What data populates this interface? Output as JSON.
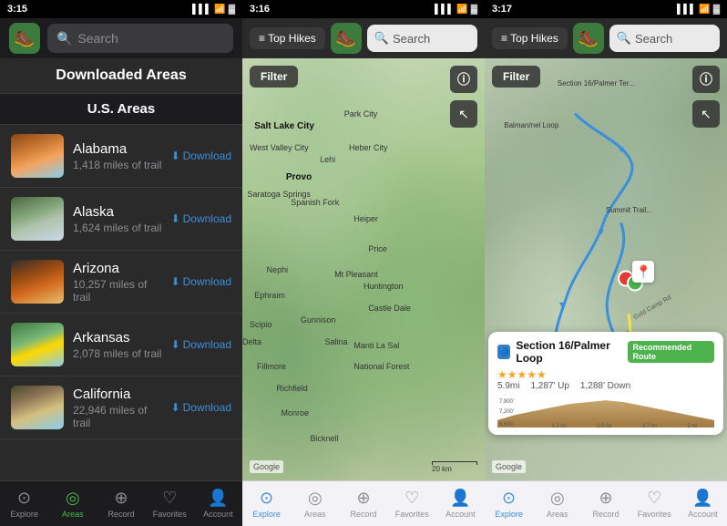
{
  "panels": [
    {
      "id": "panel-1",
      "status": {
        "time": "3:15",
        "signal": "▌▌▌",
        "wifi": "wifi",
        "battery": "🔋"
      },
      "nav": {
        "search_placeholder": "Search"
      },
      "section_title": "Downloaded Areas",
      "sub_section": "U.S. Areas",
      "areas": [
        {
          "name": "Alabama",
          "miles": "1,418 miles of trail",
          "thumb_class": "thumb-alabama"
        },
        {
          "name": "Alaska",
          "miles": "1,624 miles of trail",
          "thumb_class": "thumb-alaska"
        },
        {
          "name": "Arizona",
          "miles": "10,257 miles of trail",
          "thumb_class": "thumb-arizona"
        },
        {
          "name": "Arkansas",
          "miles": "2,078 miles of trail",
          "thumb_class": "thumb-arkansas"
        },
        {
          "name": "California",
          "miles": "22,946 miles of trail",
          "thumb_class": "thumb-california"
        }
      ],
      "download_label": "Download",
      "tabs": [
        {
          "id": "explore",
          "label": "Explore",
          "icon": "⊙",
          "active": false
        },
        {
          "id": "areas",
          "label": "Areas",
          "icon": "◎",
          "active": true
        },
        {
          "id": "record",
          "label": "Record",
          "icon": "⊕",
          "active": false
        },
        {
          "id": "favorites",
          "label": "Favorites",
          "icon": "♡",
          "active": false
        },
        {
          "id": "account",
          "label": "Account",
          "icon": "👤",
          "active": false
        }
      ]
    },
    {
      "id": "panel-2",
      "status": {
        "time": "3:16"
      },
      "nav": {
        "menu_label": "≡ Top Hikes",
        "search_placeholder": "Search"
      },
      "filter_btn": "Filter",
      "map_labels": [
        {
          "text": "Salt Lake City",
          "top": "15%",
          "left": "10%"
        },
        {
          "text": "Park City",
          "top": "13%",
          "left": "38%"
        },
        {
          "text": "West Valley City",
          "top": "18%",
          "left": "8%"
        },
        {
          "text": "Heber City",
          "top": "18%",
          "left": "42%"
        },
        {
          "text": "Provo",
          "top": "24%",
          "left": "18%",
          "bold": true
        },
        {
          "text": "Lehi",
          "top": "21%",
          "left": "30%"
        },
        {
          "text": "Saratoga Springs",
          "top": "28%",
          "left": "4%"
        },
        {
          "text": "Spanish Fork",
          "top": "31%",
          "left": "20%"
        },
        {
          "text": "Nephi",
          "top": "46%",
          "left": "14%"
        },
        {
          "text": "Ephraim",
          "top": "52%",
          "left": "9%"
        },
        {
          "text": "Scipio",
          "top": "58%",
          "left": "8%"
        },
        {
          "text": "Gunnison",
          "top": "57%",
          "left": "22%"
        },
        {
          "text": "Delta",
          "top": "63%",
          "left": "3%"
        },
        {
          "text": "Fillmore",
          "top": "68%",
          "left": "10%"
        },
        {
          "text": "Richfield",
          "top": "74%",
          "left": "16%"
        },
        {
          "text": "Monroe",
          "top": "80%",
          "left": "18%"
        },
        {
          "text": "Bicknell",
          "top": "86%",
          "left": "30%"
        },
        {
          "text": "Heiper",
          "top": "35%",
          "left": "45%"
        },
        {
          "text": "Price",
          "top": "42%",
          "left": "50%"
        },
        {
          "text": "Mt Pleasant",
          "top": "48%",
          "left": "38%"
        },
        {
          "text": "Huntington",
          "top": "50%",
          "left": "50%"
        },
        {
          "text": "Castle Dale",
          "top": "55%",
          "left": "52%"
        },
        {
          "text": "Salina",
          "top": "63%",
          "left": "35%"
        },
        {
          "text": "Manti La Sal",
          "top": "64%",
          "left": "48%"
        },
        {
          "text": "National Forest",
          "top": "68%",
          "left": "46%"
        }
      ],
      "google_label": "Google",
      "scale_label": "20 km",
      "tabs": [
        {
          "id": "explore",
          "label": "Explore",
          "icon": "⊙",
          "active": true
        },
        {
          "id": "areas",
          "label": "Areas",
          "icon": "◎",
          "active": false
        },
        {
          "id": "record",
          "label": "Record",
          "icon": "⊕",
          "active": false
        },
        {
          "id": "favorites",
          "label": "Favorites",
          "icon": "♡",
          "active": false
        },
        {
          "id": "account",
          "label": "Account",
          "icon": "👤",
          "active": false
        }
      ]
    },
    {
      "id": "panel-3",
      "status": {
        "time": "3:17"
      },
      "nav": {
        "menu_label": "≡ Top Hikes",
        "search_placeholder": "Search"
      },
      "filter_btn": "Filter",
      "trail_card": {
        "name": "Section 16/Palmer Loop",
        "recommended": "Recommended Route",
        "stars": "★★★★★",
        "stats": {
          "distance": "5.9mi",
          "elevation_up": "1,287′ Up",
          "elevation_down": "1,288′ Down"
        },
        "elevation_labels": [
          "7,900′",
          "7,200′",
          "6,600′"
        ],
        "x_labels": [
          "1.2 mi",
          "2.5 mi",
          "3.7 mi",
          "5 mi"
        ]
      },
      "google_label": "Google",
      "tabs": [
        {
          "id": "explore",
          "label": "Explore",
          "icon": "⊙",
          "active": true
        },
        {
          "id": "areas",
          "label": "Areas",
          "icon": "◎",
          "active": false
        },
        {
          "id": "record",
          "label": "Record",
          "icon": "⊕",
          "active": false
        },
        {
          "id": "favorites",
          "label": "Favorites",
          "icon": "♡",
          "active": false
        },
        {
          "id": "account",
          "label": "Account",
          "icon": "👤",
          "active": false
        }
      ]
    }
  ]
}
